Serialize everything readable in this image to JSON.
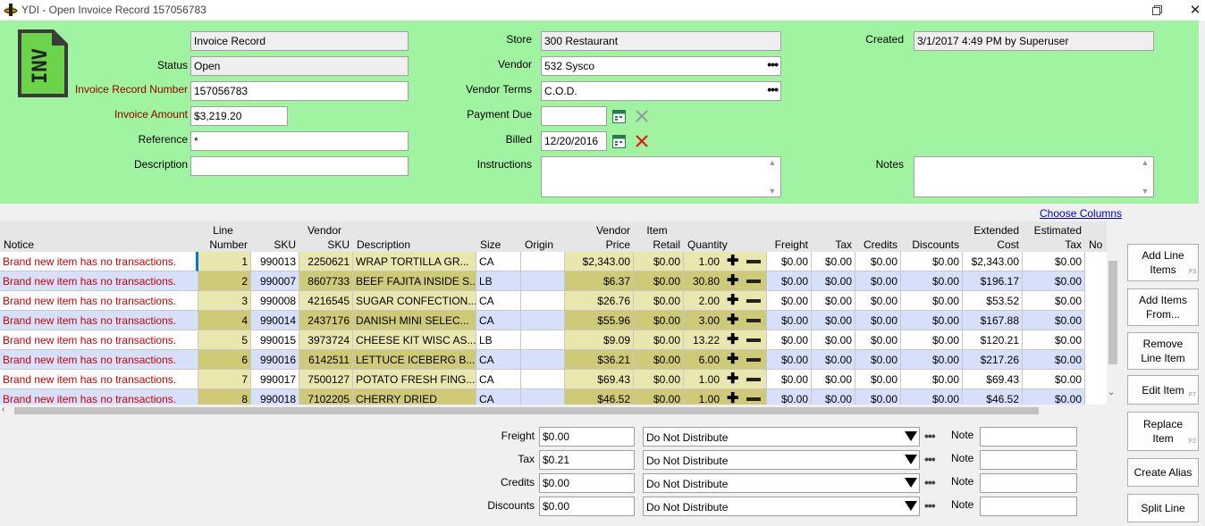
{
  "window": {
    "title": "YDI - Open Invoice Record 157056783",
    "close_glyph": "✕",
    "restore_glyph": "❐"
  },
  "header": {
    "icon_text": "INV",
    "record_type": "Invoice Record",
    "status_label": "Status",
    "status_value": "Open",
    "invoice_number_label": "Invoice Record Number",
    "invoice_number_value": "157056783",
    "invoice_amount_label": "Invoice Amount",
    "invoice_amount_value": "$3,219.20",
    "reference_label": "Reference",
    "reference_value": "*",
    "description_label": "Description",
    "description_value": "",
    "store_label": "Store",
    "store_value": "300 Restaurant",
    "vendor_label": "Vendor",
    "vendor_value": "532 Sysco",
    "vendor_terms_label": "Vendor Terms",
    "vendor_terms_value": "C.O.D.",
    "payment_due_label": "Payment Due",
    "payment_due_value": "",
    "billed_label": "Billed",
    "billed_value": "12/20/2016",
    "instructions_label": "Instructions",
    "instructions_value": "",
    "created_label": "Created",
    "created_value": "3/1/2017 4:49 PM by Superuser",
    "notes_label": "Notes",
    "notes_value": "",
    "dots": "•••"
  },
  "grid": {
    "choose_columns": "Choose Columns",
    "columns": [
      {
        "key": "notice",
        "top": "",
        "bottom": "Notice"
      },
      {
        "key": "line",
        "top": "Line",
        "bottom": "Number"
      },
      {
        "key": "sku",
        "top": "",
        "bottom": "SKU"
      },
      {
        "key": "vsku",
        "top": "Vendor",
        "bottom": "SKU"
      },
      {
        "key": "desc",
        "top": "",
        "bottom": "Description"
      },
      {
        "key": "size",
        "top": "",
        "bottom": "Size"
      },
      {
        "key": "origin",
        "top": "",
        "bottom": "Origin"
      },
      {
        "key": "vprice",
        "top": "Vendor",
        "bottom": "Price"
      },
      {
        "key": "retail",
        "top": "Item",
        "bottom": "Retail"
      },
      {
        "key": "qty",
        "top": "",
        "bottom": "Quantity"
      },
      {
        "key": "freight",
        "top": "",
        "bottom": "Freight"
      },
      {
        "key": "tax",
        "top": "",
        "bottom": "Tax"
      },
      {
        "key": "credits",
        "top": "",
        "bottom": "Credits"
      },
      {
        "key": "discounts",
        "top": "",
        "bottom": "Discounts"
      },
      {
        "key": "ext",
        "top": "Extended",
        "bottom": "Cost"
      },
      {
        "key": "esttax",
        "top": "Estimated",
        "bottom": "Tax"
      },
      {
        "key": "no",
        "top": "",
        "bottom": "No"
      }
    ],
    "rows": [
      {
        "notice": "Brand new item has no transactions.",
        "line": "1",
        "sku": "990013",
        "vsku": "2250621",
        "desc": "WRAP TORTILLA GR...",
        "size": "CA",
        "origin": "",
        "vprice": "$2,343.00",
        "retail": "$0.00",
        "qty": "1.00",
        "freight": "$0.00",
        "tax": "$0.00",
        "credits": "$0.00",
        "discounts": "$0.00",
        "ext": "$2,343.00",
        "esttax": "$0.00"
      },
      {
        "notice": "Brand new item has no transactions.",
        "line": "2",
        "sku": "990007",
        "vsku": "8607733",
        "desc": "BEEF FAJITA INSIDE S...",
        "size": "LB",
        "origin": "",
        "vprice": "$6.37",
        "retail": "$0.00",
        "qty": "30.80",
        "freight": "$0.00",
        "tax": "$0.00",
        "credits": "$0.00",
        "discounts": "$0.00",
        "ext": "$196.17",
        "esttax": "$0.00"
      },
      {
        "notice": "Brand new item has no transactions.",
        "line": "3",
        "sku": "990008",
        "vsku": "4216545",
        "desc": "SUGAR CONFECTION...",
        "size": "CA",
        "origin": "",
        "vprice": "$26.76",
        "retail": "$0.00",
        "qty": "2.00",
        "freight": "$0.00",
        "tax": "$0.00",
        "credits": "$0.00",
        "discounts": "$0.00",
        "ext": "$53.52",
        "esttax": "$0.00"
      },
      {
        "notice": "Brand new item has no transactions.",
        "line": "4",
        "sku": "990014",
        "vsku": "2437176",
        "desc": "DANISH MINI SELEC...",
        "size": "CA",
        "origin": "",
        "vprice": "$55.96",
        "retail": "$0.00",
        "qty": "3.00",
        "freight": "$0.00",
        "tax": "$0.00",
        "credits": "$0.00",
        "discounts": "$0.00",
        "ext": "$167.88",
        "esttax": "$0.00"
      },
      {
        "notice": "Brand new item has no transactions.",
        "line": "5",
        "sku": "990015",
        "vsku": "3973724",
        "desc": "CHEESE KIT WISC AS...",
        "size": "LB",
        "origin": "",
        "vprice": "$9.09",
        "retail": "$0.00",
        "qty": "13.22",
        "freight": "$0.00",
        "tax": "$0.00",
        "credits": "$0.00",
        "discounts": "$0.00",
        "ext": "$120.21",
        "esttax": "$0.00"
      },
      {
        "notice": "Brand new item has no transactions.",
        "line": "6",
        "sku": "990016",
        "vsku": "6142511",
        "desc": "LETTUCE ICEBERG B...",
        "size": "CA",
        "origin": "",
        "vprice": "$36.21",
        "retail": "$0.00",
        "qty": "6.00",
        "freight": "$0.00",
        "tax": "$0.00",
        "credits": "$0.00",
        "discounts": "$0.00",
        "ext": "$217.26",
        "esttax": "$0.00"
      },
      {
        "notice": "Brand new item has no transactions.",
        "line": "7",
        "sku": "990017",
        "vsku": "7500127",
        "desc": "POTATO FRESH FING...",
        "size": "CA",
        "origin": "",
        "vprice": "$69.43",
        "retail": "$0.00",
        "qty": "1.00",
        "freight": "$0.00",
        "tax": "$0.00",
        "credits": "$0.00",
        "discounts": "$0.00",
        "ext": "$69.43",
        "esttax": "$0.00"
      },
      {
        "notice": "Brand new item has no transactions.",
        "line": "8",
        "sku": "990018",
        "vsku": "7102205",
        "desc": "CHERRY DRIED",
        "size": "CA",
        "origin": "",
        "vprice": "$46.52",
        "retail": "$0.00",
        "qty": "1.00",
        "freight": "$0.00",
        "tax": "$0.00",
        "credits": "$0.00",
        "discounts": "$0.00",
        "ext": "$46.52",
        "esttax": "$0.00"
      }
    ]
  },
  "buttons": {
    "add_line_items": "Add Line Items",
    "add_line_items_key": "F3",
    "add_items_from": "Add Items From...",
    "remove_line_item": "Remove Line Item",
    "edit_item": "Edit Item",
    "edit_item_key": "F7",
    "replace_item": "Replace Item",
    "replace_item_key": "F2",
    "create_alias": "Create Alias",
    "split_line": "Split Line"
  },
  "bottom": {
    "rows": [
      {
        "label": "Freight",
        "value": "$0.00",
        "distribute": "Do Not Distribute",
        "note_label": "Note",
        "note_value": ""
      },
      {
        "label": "Tax",
        "value": "$0.21",
        "distribute": "Do Not Distribute",
        "note_label": "Note",
        "note_value": ""
      },
      {
        "label": "Credits",
        "value": "$0.00",
        "distribute": "Do Not Distribute",
        "note_label": "Note",
        "note_value": ""
      },
      {
        "label": "Discounts",
        "value": "$0.00",
        "distribute": "Do Not Distribute",
        "note_label": "Note",
        "note_value": ""
      }
    ]
  },
  "colors": {
    "header_bg": "#a0f3a0",
    "row_even": "#ffffff",
    "row_odd": "#d6e0fb",
    "yellow_cell": "#e9e6ae",
    "yellow_cell_odd": "#cfca78",
    "notice_text": "#cc0000",
    "selected": "#0078d7"
  }
}
